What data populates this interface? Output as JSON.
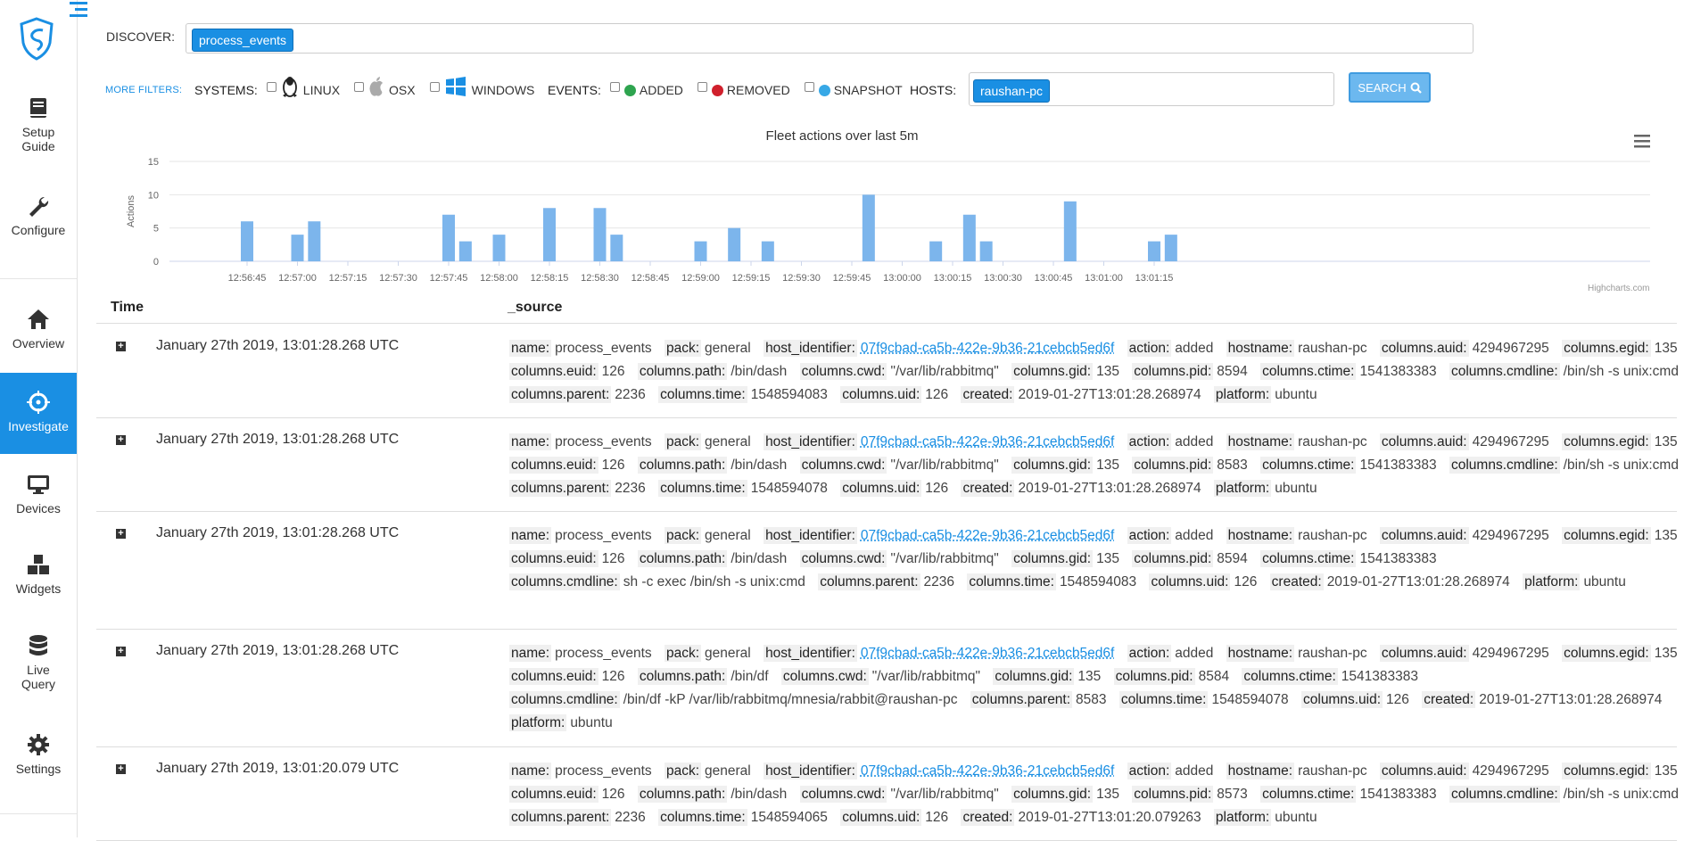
{
  "sidebar": {
    "items": [
      {
        "label": "Setup Guide",
        "line1": "Setup",
        "line2": "Guide",
        "icon": "book-icon"
      },
      {
        "label": "Configure",
        "line1": "Configure",
        "line2": "",
        "icon": "wrench-icon"
      },
      {
        "label": "Overview",
        "line1": "Overview",
        "line2": "",
        "icon": "home-icon"
      },
      {
        "label": "Investigate",
        "line1": "Investigate",
        "line2": "",
        "icon": "crosshair-icon"
      },
      {
        "label": "Devices",
        "line1": "Devices",
        "line2": "",
        "icon": "monitor-icon"
      },
      {
        "label": "Widgets",
        "line1": "Widgets",
        "line2": "",
        "icon": "boxes-icon"
      },
      {
        "label": "Live Query",
        "line1": "Live",
        "line2": "Query",
        "icon": "database-icon"
      },
      {
        "label": "Settings",
        "line1": "Settings",
        "line2": "",
        "icon": "gear-icon"
      }
    ],
    "active": "Investigate",
    "accent": "#1a8fe3"
  },
  "discover": {
    "label": "DISCOVER:",
    "tag": "process_events"
  },
  "filters": {
    "more": "MORE FILTERS:",
    "systems_label": "SYSTEMS:",
    "systems": [
      "LINUX",
      "OSX",
      "WINDOWS"
    ],
    "events_label": "EVENTS:",
    "events": [
      {
        "label": "ADDED",
        "color": "#2ea44f"
      },
      {
        "label": "REMOVED",
        "color": "#d0202c"
      },
      {
        "label": "SNAPSHOT",
        "color": "#37a8e6"
      }
    ],
    "hosts_label": "HOSTS:",
    "host_tag": "raushan-pc",
    "search_label": "SEARCH"
  },
  "chart_data": {
    "type": "bar",
    "title": "Fleet actions over last 5m",
    "ylabel": "Actions",
    "xlabel": "",
    "ylim": [
      0,
      15
    ],
    "yticks": [
      0,
      5,
      10,
      15
    ],
    "xticks": [
      "12:56:45",
      "12:57:00",
      "12:57:15",
      "12:57:30",
      "12:57:45",
      "12:58:00",
      "12:58:15",
      "12:58:30",
      "12:58:45",
      "12:59:00",
      "12:59:15",
      "12:59:30",
      "12:59:45",
      "13:00:00",
      "13:00:15",
      "13:00:30",
      "13:00:45",
      "13:01:00",
      "13:01:15"
    ],
    "x": [
      "12:56:45",
      "12:57:00",
      "12:57:05",
      "12:57:45",
      "12:57:50",
      "12:58:00",
      "12:58:15",
      "12:58:30",
      "12:58:35",
      "12:59:00",
      "12:59:10",
      "12:59:20",
      "12:59:50",
      "13:00:10",
      "13:00:20",
      "13:00:25",
      "13:00:50",
      "13:01:15",
      "13:01:20"
    ],
    "values": [
      6,
      4,
      6,
      7,
      3,
      4,
      8,
      8,
      4,
      3,
      5,
      3,
      10,
      3,
      7,
      3,
      9,
      3,
      4
    ],
    "grid": true,
    "bar_color": "#7cb5ec",
    "credits": "Highcharts.com"
  },
  "table": {
    "headers": [
      "Time",
      "_source"
    ],
    "rows": [
      {
        "time": "January 27th 2019, 13:01:28.268 UTC",
        "fields": [
          [
            "name:",
            "process_events"
          ],
          [
            "pack:",
            "general"
          ],
          [
            "host_identifier:",
            "07f9cbad-ca5b-422e-9b36-21cebcb5ed6f"
          ],
          [
            "action:",
            "added"
          ],
          [
            "hostname:",
            "raushan-pc"
          ],
          [
            "columns.auid:",
            "4294967295"
          ],
          [
            "columns.egid:",
            "135"
          ],
          [
            "columns.euid:",
            "126"
          ],
          [
            "columns.path:",
            "/bin/dash"
          ],
          [
            "columns.cwd:",
            "\"/var/lib/rabbitmq\""
          ],
          [
            "columns.gid:",
            "135"
          ],
          [
            "columns.pid:",
            "8594"
          ],
          [
            "columns.ctime:",
            "1541383383"
          ],
          [
            "columns.cmdline:",
            "/bin/sh -s unix:cmd"
          ],
          [
            "columns.parent:",
            "2236"
          ],
          [
            "columns.time:",
            "1548594083"
          ],
          [
            "columns.uid:",
            "126"
          ],
          [
            "created:",
            "2019-01-27T13:01:28.268974"
          ],
          [
            "platform:",
            "ubuntu"
          ]
        ]
      },
      {
        "time": "January 27th 2019, 13:01:28.268 UTC",
        "fields": [
          [
            "name:",
            "process_events"
          ],
          [
            "pack:",
            "general"
          ],
          [
            "host_identifier:",
            "07f9cbad-ca5b-422e-9b36-21cebcb5ed6f"
          ],
          [
            "action:",
            "added"
          ],
          [
            "hostname:",
            "raushan-pc"
          ],
          [
            "columns.auid:",
            "4294967295"
          ],
          [
            "columns.egid:",
            "135"
          ],
          [
            "columns.euid:",
            "126"
          ],
          [
            "columns.path:",
            "/bin/dash"
          ],
          [
            "columns.cwd:",
            "\"/var/lib/rabbitmq\""
          ],
          [
            "columns.gid:",
            "135"
          ],
          [
            "columns.pid:",
            "8583"
          ],
          [
            "columns.ctime:",
            "1541383383"
          ],
          [
            "columns.cmdline:",
            "/bin/sh -s unix:cmd"
          ],
          [
            "columns.parent:",
            "2236"
          ],
          [
            "columns.time:",
            "1548594078"
          ],
          [
            "columns.uid:",
            "126"
          ],
          [
            "created:",
            "2019-01-27T13:01:28.268974"
          ],
          [
            "platform:",
            "ubuntu"
          ]
        ]
      },
      {
        "time": "January 27th 2019, 13:01:28.268 UTC",
        "fields": [
          [
            "name:",
            "process_events"
          ],
          [
            "pack:",
            "general"
          ],
          [
            "host_identifier:",
            "07f9cbad-ca5b-422e-9b36-21cebcb5ed6f"
          ],
          [
            "action:",
            "added"
          ],
          [
            "hostname:",
            "raushan-pc"
          ],
          [
            "columns.auid:",
            "4294967295"
          ],
          [
            "columns.egid:",
            "135"
          ],
          [
            "columns.euid:",
            "126"
          ],
          [
            "columns.path:",
            "/bin/dash"
          ],
          [
            "columns.cwd:",
            "\"/var/lib/rabbitmq\""
          ],
          [
            "columns.gid:",
            "135"
          ],
          [
            "columns.pid:",
            "8594"
          ],
          [
            "columns.ctime:",
            "1541383383"
          ],
          [
            "columns.cmdline:",
            "sh -c exec /bin/sh -s unix:cmd"
          ],
          [
            "columns.parent:",
            "2236"
          ],
          [
            "columns.time:",
            "1548594083"
          ],
          [
            "columns.uid:",
            "126"
          ],
          [
            "created:",
            "2019-01-27T13:01:28.268974"
          ],
          [
            "platform:",
            "ubuntu"
          ]
        ]
      },
      {
        "time": "January 27th 2019, 13:01:28.268 UTC",
        "fields": [
          [
            "name:",
            "process_events"
          ],
          [
            "pack:",
            "general"
          ],
          [
            "host_identifier:",
            "07f9cbad-ca5b-422e-9b36-21cebcb5ed6f"
          ],
          [
            "action:",
            "added"
          ],
          [
            "hostname:",
            "raushan-pc"
          ],
          [
            "columns.auid:",
            "4294967295"
          ],
          [
            "columns.egid:",
            "135"
          ],
          [
            "columns.euid:",
            "126"
          ],
          [
            "columns.path:",
            "/bin/df"
          ],
          [
            "columns.cwd:",
            "\"/var/lib/rabbitmq\""
          ],
          [
            "columns.gid:",
            "135"
          ],
          [
            "columns.pid:",
            "8584"
          ],
          [
            "columns.ctime:",
            "1541383383"
          ],
          [
            "columns.cmdline:",
            "/bin/df -kP /var/lib/rabbitmq/mnesia/rabbit@raushan-pc"
          ],
          [
            "columns.parent:",
            "8583"
          ],
          [
            "columns.time:",
            "1548594078"
          ],
          [
            "columns.uid:",
            "126"
          ],
          [
            "created:",
            "2019-01-27T13:01:28.268974"
          ],
          [
            "platform:",
            "ubuntu"
          ]
        ]
      },
      {
        "time": "January 27th 2019, 13:01:20.079 UTC",
        "fields": [
          [
            "name:",
            "process_events"
          ],
          [
            "pack:",
            "general"
          ],
          [
            "host_identifier:",
            "07f9cbad-ca5b-422e-9b36-21cebcb5ed6f"
          ],
          [
            "action:",
            "added"
          ],
          [
            "hostname:",
            "raushan-pc"
          ],
          [
            "columns.auid:",
            "4294967295"
          ],
          [
            "columns.egid:",
            "135"
          ],
          [
            "columns.euid:",
            "126"
          ],
          [
            "columns.path:",
            "/bin/dash"
          ],
          [
            "columns.cwd:",
            "\"/var/lib/rabbitmq\""
          ],
          [
            "columns.gid:",
            "135"
          ],
          [
            "columns.pid:",
            "8573"
          ],
          [
            "columns.ctime:",
            "1541383383"
          ],
          [
            "columns.cmdline:",
            "/bin/sh -s unix:cmd"
          ],
          [
            "columns.parent:",
            "2236"
          ],
          [
            "columns.time:",
            "1548594065"
          ],
          [
            "columns.uid:",
            "126"
          ],
          [
            "created:",
            "2019-01-27T13:01:20.079263"
          ],
          [
            "platform:",
            "ubuntu"
          ]
        ]
      }
    ]
  }
}
